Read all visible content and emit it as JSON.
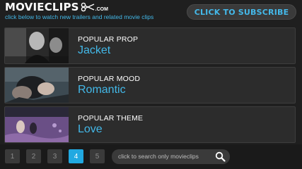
{
  "header": {
    "logo_text": "MOVIECLIPS",
    "logo_suffix": ".COM",
    "tagline": "click below to watch new trailers and related movie clips",
    "subscribe_label": "CLICK TO SUBSCRIBE"
  },
  "rows": [
    {
      "kicker": "POPULAR PROP",
      "value": "Jacket"
    },
    {
      "kicker": "POPULAR MOOD",
      "value": "Romantic"
    },
    {
      "kicker": "POPULAR THEME",
      "value": "Love"
    }
  ],
  "pagination": {
    "pages": [
      "1",
      "2",
      "3",
      "4",
      "5"
    ],
    "active": "4"
  },
  "search": {
    "placeholder": "click to search only movieclips",
    "icon": "search-icon"
  },
  "colors": {
    "accent": "#43b8e8",
    "active_page": "#21a9e1",
    "background": "#1f1f1f"
  }
}
